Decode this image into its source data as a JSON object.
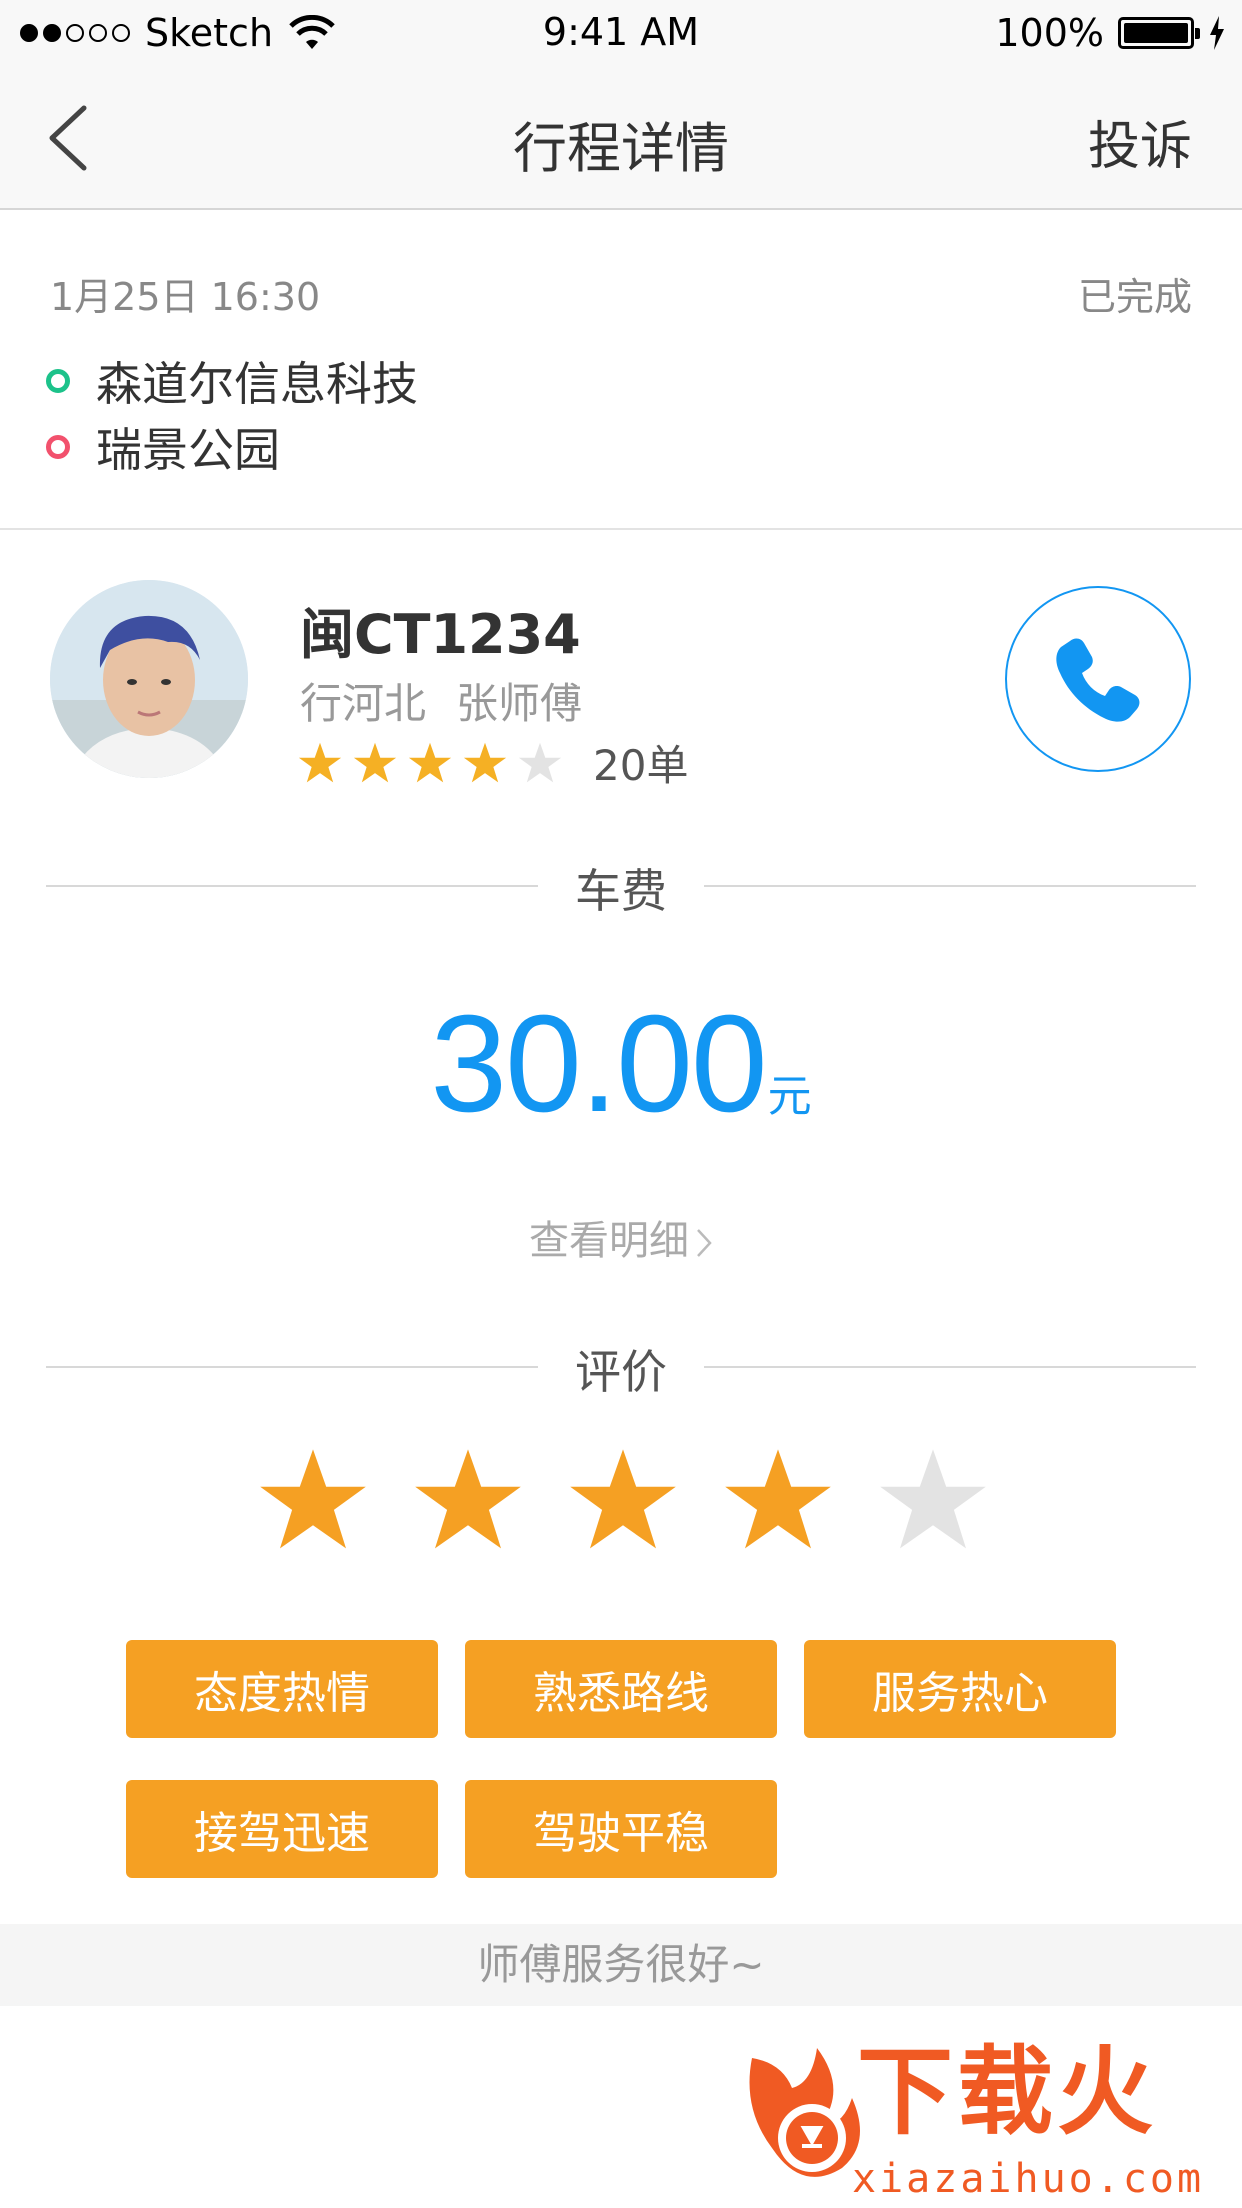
{
  "status_bar": {
    "carrier": "Sketch",
    "time": "9:41 AM",
    "battery": "100%"
  },
  "nav": {
    "title": "行程详情",
    "action": "投诉"
  },
  "trip": {
    "datetime": "1月25日 16:30",
    "status": "已完成",
    "start": "森道尔信息科技",
    "end": "瑞景公园"
  },
  "driver": {
    "plate": "闽CT1234",
    "company": "行河北",
    "name": "张师傅",
    "rating": 4,
    "rating_max": 5,
    "orders": "20单"
  },
  "fare": {
    "section_label": "车费",
    "amount": "30.00",
    "unit": "元",
    "detail_link": "查看明细"
  },
  "review": {
    "section_label": "评价",
    "stars": 4,
    "stars_max": 5,
    "tags": [
      "态度热情",
      "熟悉路线",
      "服务热心",
      "接驾迅速",
      "驾驶平稳"
    ],
    "comment": "师傅服务很好~"
  },
  "watermark": {
    "brand": "下载火",
    "url": "xiazaihuo.com"
  },
  "colors": {
    "accent_blue": "#1296f2",
    "tag_orange": "#f5a023",
    "star_gold": "#f5b024",
    "star_orange": "#f5a023",
    "star_empty": "#e3e3e3",
    "start_green": "#1cc28a",
    "end_red": "#f2516d"
  }
}
